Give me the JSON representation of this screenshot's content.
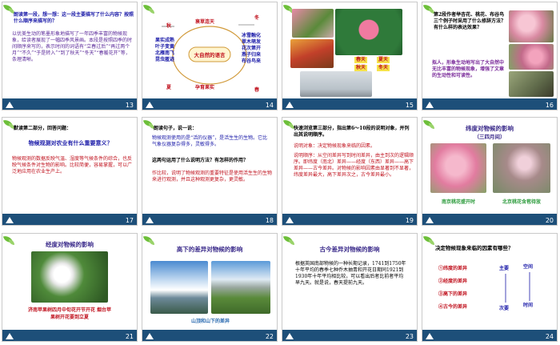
{
  "slides": [
    {
      "num": "13",
      "q": "朗读第一段，想一想：这一段主要描写了什么内容？按照什么顺序来描写的？",
      "ans": "以优美生动的笔墨形象地描写了一年四季丰富的物候现象，给读者展现了一幅四季风景画。本段是按照四季的时间顺序来写的，表示时间的词语有“立春过后”“再过两个月”“不久”“于是转入”“到了秋天”“冬天”“春暖花开”等，条理清晰。"
    },
    {
      "num": "14",
      "winter": "冬",
      "autumn": "秋",
      "summer": "夏",
      "spring": "春",
      "top": "衰草连天",
      "bottom": "孕育果实",
      "center": "大自然的语言",
      "left": "果实成熟 叶子变黄 北雁南飞 昆虫匿迹",
      "right": "冰雪融化 草木萌发 花次第开 燕子归来 布谷鸟来"
    },
    {
      "num": "15",
      "labels": [
        "春天",
        "夏天",
        "秋天",
        "冬天"
      ]
    },
    {
      "num": "16",
      "q": "第2段作者举杏花、桃花、布谷鸟三个例子时采用了什么修辞方法？有什么样的表达效果？",
      "ans": "拟人，形象生动地写出了大自然中无比丰富的物候现象，增强了文章的生动性和可读性。"
    },
    {
      "num": "17",
      "q": "默读第二部分，回答问题：",
      "q2": "物候观测对农业有什么重要意义？",
      "ans": "物候观测的数据反映气温、湿度等气候条件的综合，也反映气候条件对生物的影响。比较简便，容易掌握，可以广泛地应用在农业生产上。"
    },
    {
      "num": "18",
      "q": "朗读句子，说一说：",
      "quote": "物候观测使用的是“活的仪器”，是活生生的生物。它比气象仪器复杂得多，灵敏得多。",
      "q2": "这两句运用了什么说明方法？有怎样的作用？",
      "ans": "作比较，说明了物候观测的重要特征是使用活生生的生物来进行观测，并且这种观测更复杂，更灵敏。"
    },
    {
      "num": "19",
      "q": "快速浏览第三部分，指出第6～10段的说明对象，并列出其说明顺序。",
      "a1": "说明对象：决定物候现象来临的因素。",
      "a2": "说明顺序：从空间差异写到时间差异，由主到次的逻辑顺序。即纬度（南北）差异——经度（东西）差异——高下差异——古今差异。对物候的影响因素由显著到不显著，纬度差异最大，高下差异次之，古今差异最小。"
    },
    {
      "num": "20",
      "title": "纬度对物候的影响",
      "sub": "（三四月间）",
      "cap1": "南京桃花盛开时",
      "cap2": "北京桃花含苞待放"
    },
    {
      "num": "21",
      "title": "经度对物候的影响",
      "cap": "济南苹果树四月中旬花开节开花 烟台苹果树开花要到立夏"
    },
    {
      "num": "22",
      "title": "高下的差异对物候的影响",
      "cap": "山顶和山下的差异"
    },
    {
      "num": "23",
      "title": "古今差异对物候的影响",
      "body": "根据英国南部物候的一种长期记录，1741到1750年十年平均的春季七种乔木抽青和开花日期同1921到1930年十年平均相比较，可以看出后者比前者平均早九天。就是说，春天提前九天。"
    },
    {
      "num": "24",
      "title": "决定物候现象来临的因素有哪些？",
      "items": [
        "①纬度的差异",
        "②经度的差异",
        "③高下的差异",
        "④古今的差异"
      ],
      "main": "主要",
      "space": "空间",
      "sec": "次要",
      "time": "时间"
    }
  ],
  "colors": {
    "footer": "#1d4f79",
    "blueText": "#1a1aa8",
    "redText": "#c0121e",
    "purpleText": "#7a2a9a",
    "leaf": "#6dbf3a"
  }
}
